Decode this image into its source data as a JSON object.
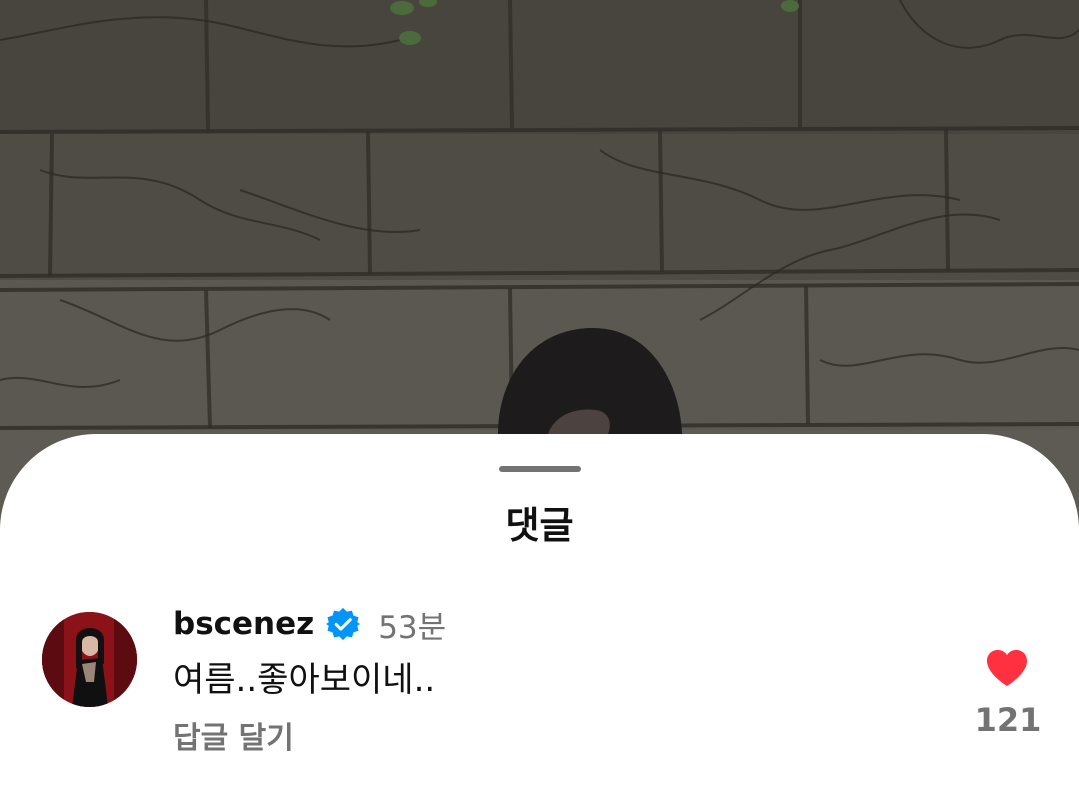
{
  "sheet": {
    "title": "댓글"
  },
  "comment": {
    "username": "bscenez",
    "verified": true,
    "timestamp": "53분",
    "text": "여름..좋아보이네..",
    "reply_label": "답글 달기",
    "like_count": "121",
    "avatar_icon": "profile-photo",
    "verified_icon": "verified-badge-icon",
    "like_icon": "heart-icon"
  },
  "colors": {
    "accent_blue": "#0095f6",
    "like_red": "#ff3040",
    "muted_text": "#737373",
    "primary_text": "#111111"
  }
}
